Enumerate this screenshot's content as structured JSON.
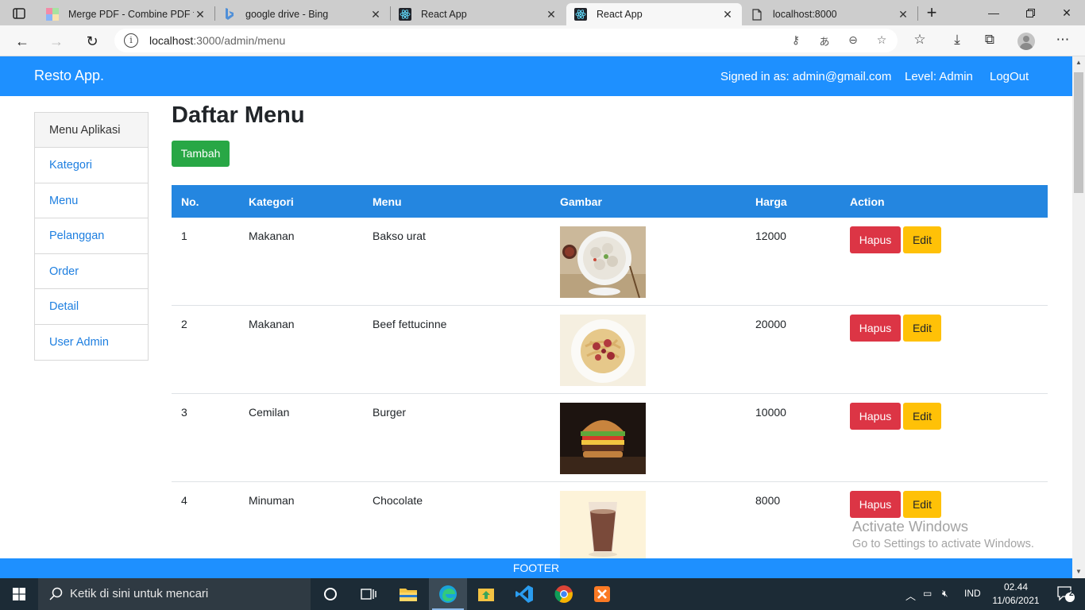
{
  "browser": {
    "tabs": [
      {
        "title": "Merge PDF - Combine PDF fi",
        "icon": "pdf-merge-icon"
      },
      {
        "title": "google drive - Bing",
        "icon": "bing-icon"
      },
      {
        "title": "React App",
        "icon": "react-icon"
      },
      {
        "title": "React App",
        "icon": "react-icon",
        "active": true
      },
      {
        "title": "localhost:8000",
        "icon": "page-icon"
      }
    ],
    "url_host": "localhost",
    "url_path": ":3000/admin/menu"
  },
  "app": {
    "brand": "Resto App.",
    "signed_in": "Signed in as: admin@gmail.com",
    "level": "Level: Admin",
    "logout": "LogOut"
  },
  "sidebar": {
    "title": "Menu Aplikasi",
    "items": [
      "Kategori",
      "Menu",
      "Pelanggan",
      "Order",
      "Detail",
      "User Admin"
    ]
  },
  "main": {
    "title": "Daftar Menu",
    "add_button": "Tambah",
    "columns": [
      "No.",
      "Kategori",
      "Menu",
      "Gambar",
      "Harga",
      "Action"
    ],
    "rows": [
      {
        "no": "1",
        "kategori": "Makanan",
        "menu": "Bakso urat",
        "harga": "12000"
      },
      {
        "no": "2",
        "kategori": "Makanan",
        "menu": "Beef fettucinne",
        "harga": "20000"
      },
      {
        "no": "3",
        "kategori": "Cemilan",
        "menu": "Burger",
        "harga": "10000"
      },
      {
        "no": "4",
        "kategori": "Minuman",
        "menu": "Chocolate",
        "harga": "8000"
      }
    ],
    "delete_label": "Hapus",
    "edit_label": "Edit"
  },
  "watermark": {
    "line1": "Activate Windows",
    "line2": "Go to Settings to activate Windows."
  },
  "footer": "FOOTER",
  "taskbar": {
    "search_placeholder": "Ketik di sini untuk mencari",
    "lang": "IND",
    "time": "02.44",
    "date": "11/06/2021",
    "notifications": "2"
  },
  "colors": {
    "nav": "#1e90ff",
    "table_head": "#2486e0",
    "success": "#28a745",
    "danger": "#dc3545",
    "warning": "#ffc107",
    "link": "#1e7fe0"
  }
}
